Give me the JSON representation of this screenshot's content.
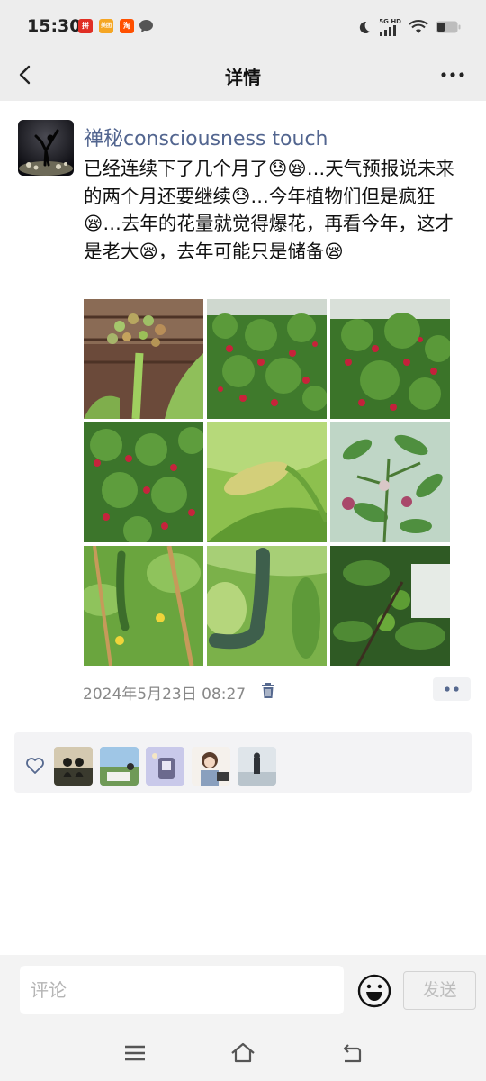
{
  "status_bar": {
    "time": "15:30",
    "apps": [
      {
        "name": "pinduoduo-app-icon",
        "label": "拼",
        "color": "#e02e24"
      },
      {
        "name": "meituan-app-icon",
        "label": "美团",
        "color": "#f5a623"
      },
      {
        "name": "taobao-app-icon",
        "label": "淘",
        "color": "#ff5000"
      }
    ],
    "network_label": "5G HD"
  },
  "nav": {
    "title": "详情"
  },
  "post": {
    "username": "禅秘consciousness touch",
    "text": "已经连续下了几个月了😓😪…天气预报说未来的两个月还要继续😓…今年植物们但是疯狂😪…去年的花量就觉得爆花，再看今年，这才是老大😪，去年可能只是储备😪",
    "timestamp": "2024年5月23日 08:27",
    "photos": [
      {
        "name": "photo-flower-buds"
      },
      {
        "name": "photo-red-flowering-shrub-1"
      },
      {
        "name": "photo-red-flowering-shrub-2"
      },
      {
        "name": "photo-red-flowering-shrub-3"
      },
      {
        "name": "photo-green-bud"
      },
      {
        "name": "photo-berry-plant"
      },
      {
        "name": "photo-cucumber-vine"
      },
      {
        "name": "photo-dark-cucumber"
      },
      {
        "name": "photo-green-citrus"
      }
    ]
  },
  "likes": {
    "avatars": [
      {
        "name": "liker-avatar-1"
      },
      {
        "name": "liker-avatar-2"
      },
      {
        "name": "liker-avatar-3"
      },
      {
        "name": "liker-avatar-4"
      },
      {
        "name": "liker-avatar-5"
      }
    ]
  },
  "comment_bar": {
    "placeholder": "评论",
    "send_label": "发送"
  },
  "colors": {
    "accent_username": "#52658f",
    "panel_bg": "#f3f3f5",
    "header_bg": "#ededed"
  }
}
